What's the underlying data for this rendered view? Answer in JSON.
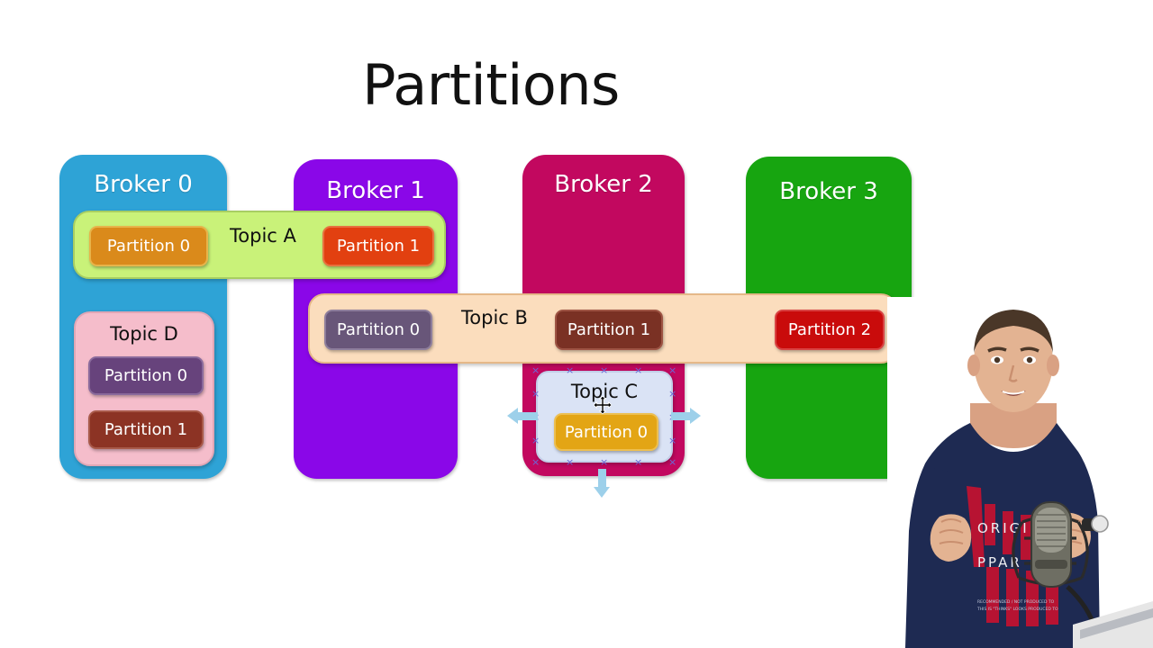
{
  "slide": {
    "title": "Partitions",
    "background": "#ffffff"
  },
  "brokers": [
    {
      "label": "Broker 0",
      "color": "#2EA3D6"
    },
    {
      "label": "Broker 1",
      "color": "#8A07E8"
    },
    {
      "label": "Broker 2",
      "color": "#C2085F"
    },
    {
      "label": "Broker 3",
      "color": "#17A510"
    }
  ],
  "topics": [
    {
      "label": "Topic A",
      "color": "#C9F279",
      "spans": [
        "Broker 0",
        "Broker 1"
      ],
      "partitions": [
        {
          "label": "Partition 0",
          "color": "#DA8A1B",
          "broker": "Broker 0"
        },
        {
          "label": "Partition 1",
          "color": "#E24010",
          "broker": "Broker 1"
        }
      ]
    },
    {
      "label": "Topic B",
      "color": "#FBDDBD",
      "spans": [
        "Broker 1",
        "Broker 2",
        "Broker 3"
      ],
      "partitions": [
        {
          "label": "Partition 0",
          "color": "#685679",
          "broker": "Broker 1"
        },
        {
          "label": "Partition 1",
          "color": "#7A3124",
          "broker": "Broker 2"
        },
        {
          "label": "Partition 2",
          "color": "#C90B0B",
          "broker": "Broker 3"
        }
      ]
    },
    {
      "label": "Topic C",
      "color": "#DAE3F5",
      "spans": [
        "Broker 2"
      ],
      "selected": true,
      "partitions": [
        {
          "label": "Partition 0",
          "color": "#E3A515",
          "broker": "Broker 2"
        }
      ]
    },
    {
      "label": "Topic D",
      "color": "#F5BDCB",
      "spans": [
        "Broker 0"
      ],
      "partitions": [
        {
          "label": "Partition 0",
          "color": "#67437C",
          "broker": "Broker 0"
        },
        {
          "label": "Partition 1",
          "color": "#8C3324",
          "broker": "Broker 0"
        }
      ]
    }
  ],
  "selection": {
    "target": "Topic C",
    "handle_glyph": "×",
    "handle_color": "#6A6AD8",
    "arrow_color": "#9DD0EA",
    "cursor": "move"
  },
  "webcam": {
    "shirt_color": "#1E2A52",
    "shirt_print_color": "#C41230",
    "shirt_text_line_1": "ORIGI",
    "shirt_text_line_2": "PPAR",
    "microphone": "studio-condenser-microphone"
  }
}
